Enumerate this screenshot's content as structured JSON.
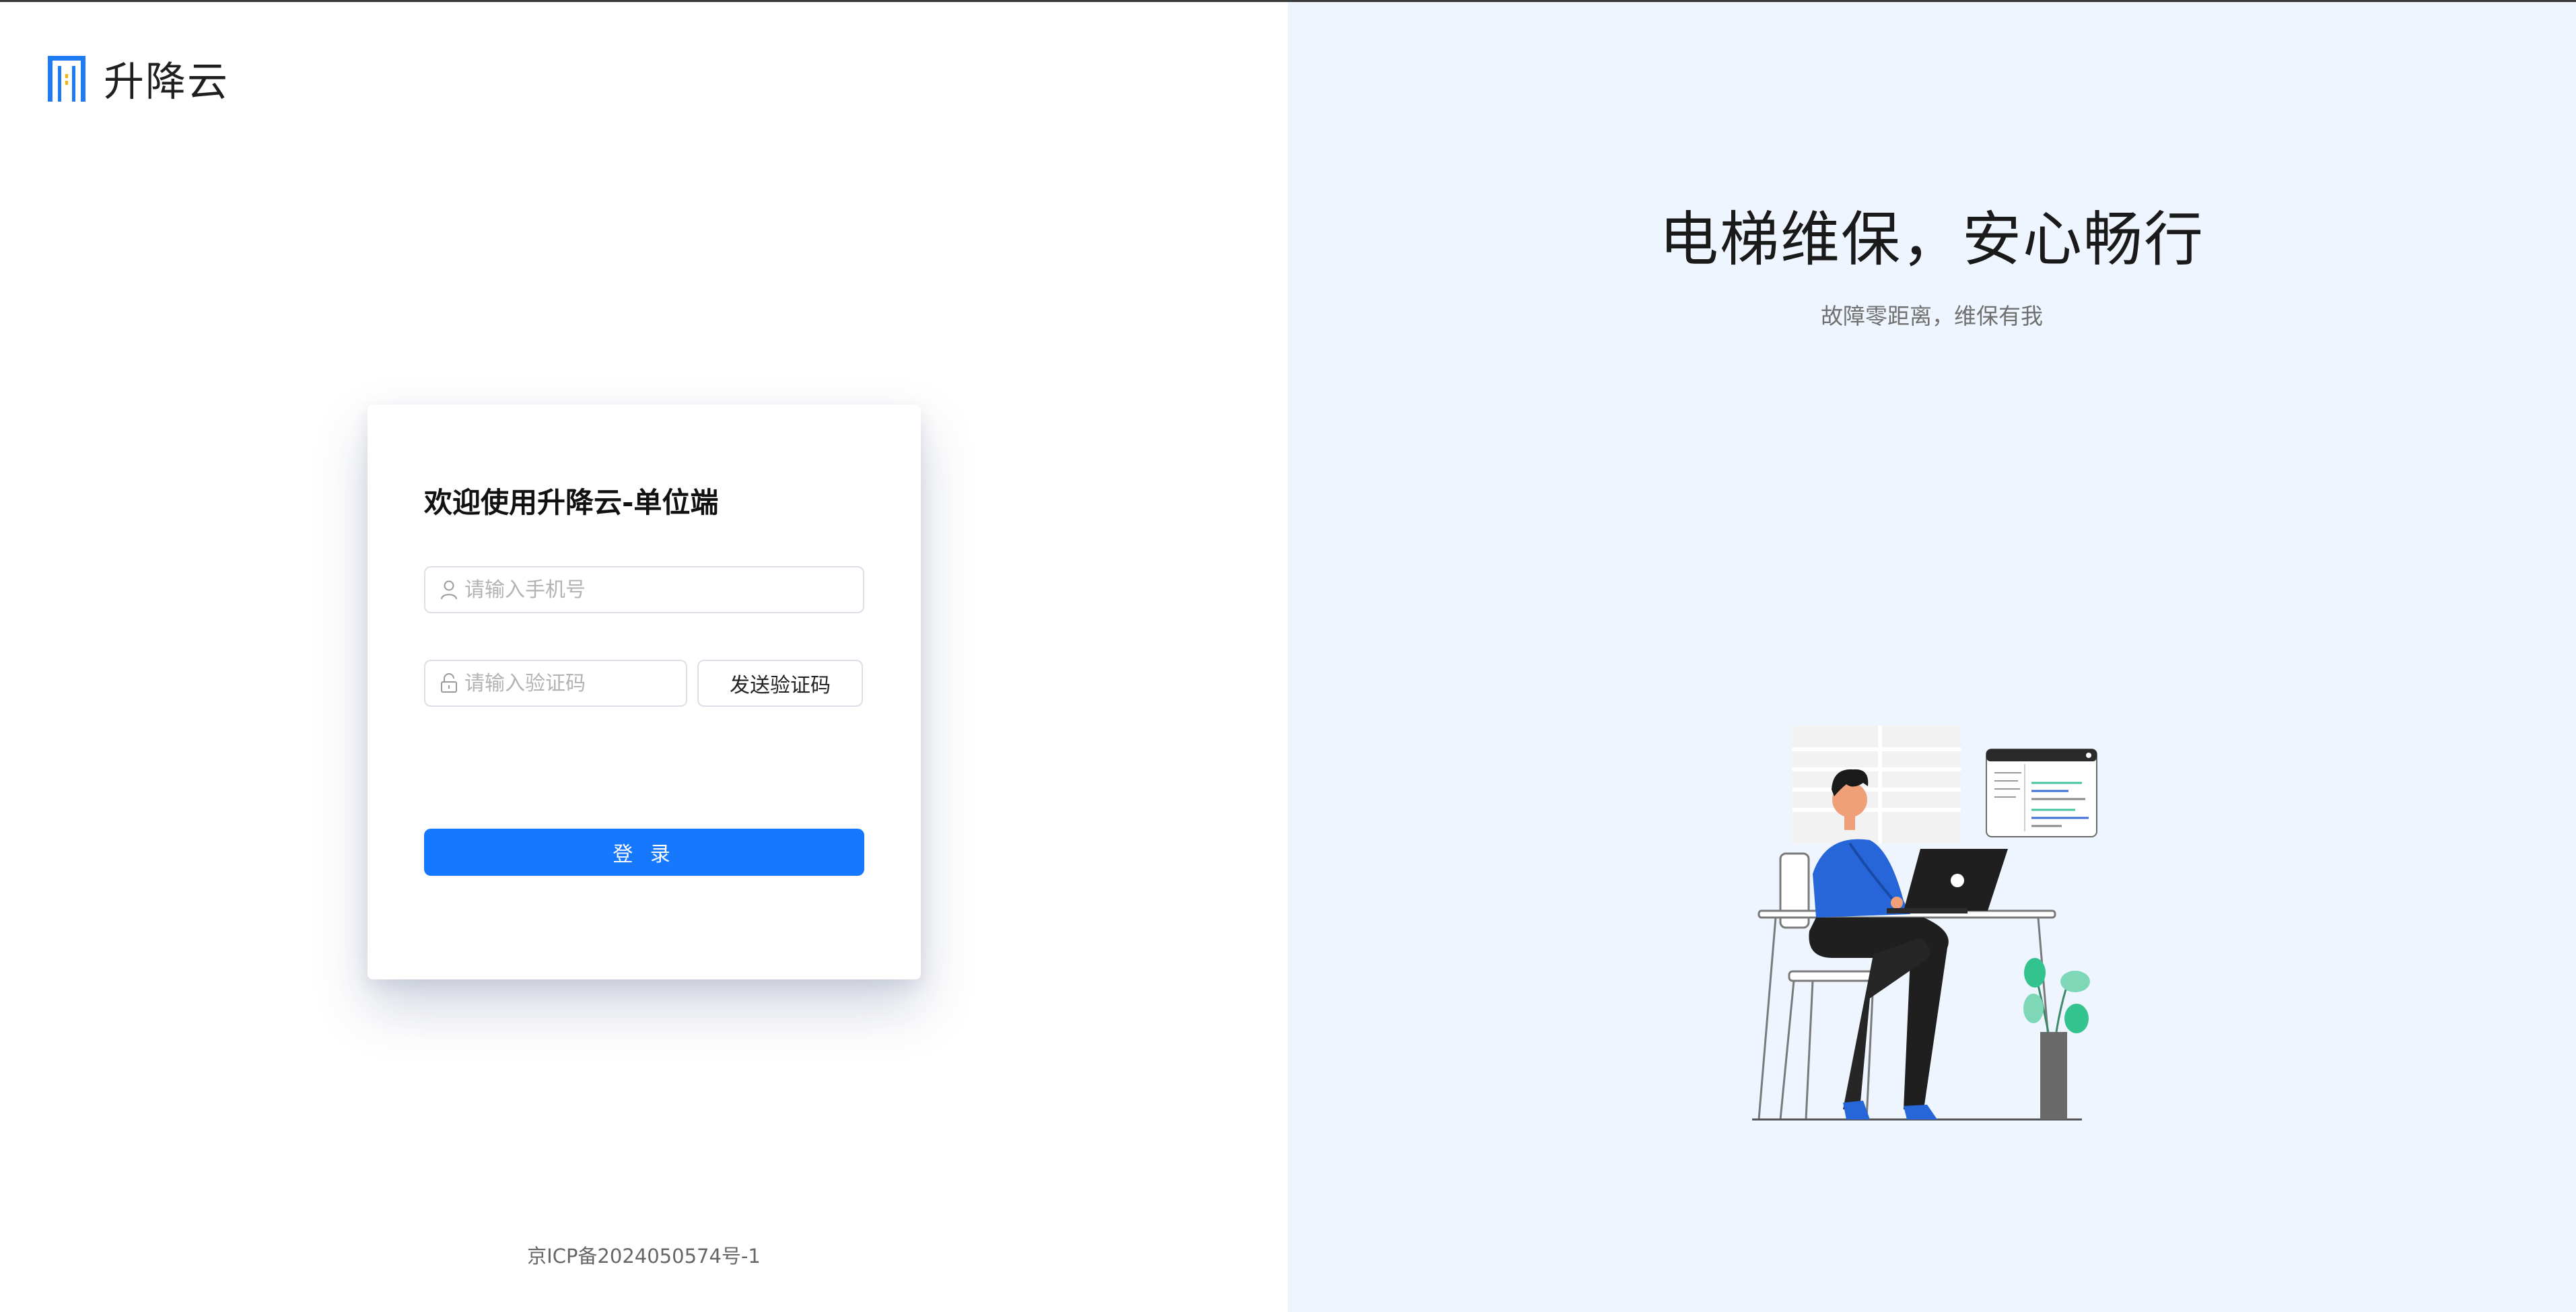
{
  "brand": {
    "name": "升降云"
  },
  "login": {
    "title": "欢迎使用升降云-单位端",
    "phone_placeholder": "请输入手机号",
    "code_placeholder": "请输入验证码",
    "send_code_label": "发送验证码",
    "submit_label": "登 录"
  },
  "footer": {
    "icp": "京ICP备2024050574号-1"
  },
  "hero": {
    "headline": "电梯维保，安心畅行",
    "subline": "故障零距离，维保有我"
  },
  "colors": {
    "primary": "#1677ff",
    "right_panel_bg": "#eef5fe",
    "logo_blue": "#1f7af5",
    "logo_yellow": "#f4b400"
  }
}
